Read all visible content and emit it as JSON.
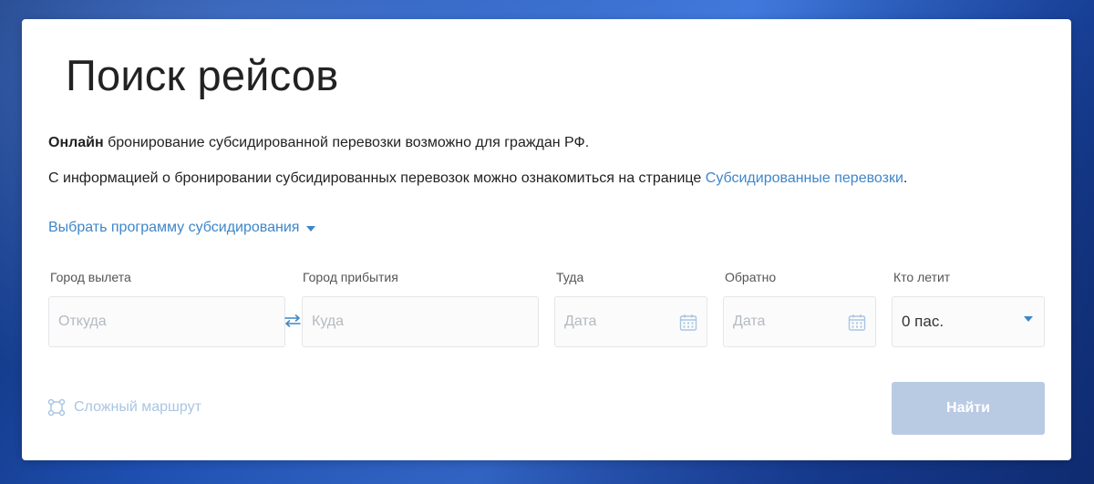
{
  "page": {
    "title": "Поиск рейсов"
  },
  "info": {
    "online_bold": "Онлайн",
    "online_rest": " бронирование субсидированной перевозки возможно для граждан РФ.",
    "info_text": "С информацией о бронировании субсидированных перевозок можно ознакомиться на странице ",
    "info_link": "Субсидированные перевозки",
    "info_end": "."
  },
  "program_selector": {
    "label": "Выбрать программу субсидирования",
    "icon": "caret-down-icon"
  },
  "form": {
    "from": {
      "label": "Город вылета",
      "placeholder": "Откуда"
    },
    "to": {
      "label": "Город прибытия",
      "placeholder": "Куда"
    },
    "depart": {
      "label": "Туда",
      "placeholder": "Дата",
      "icon": "calendar-icon"
    },
    "return": {
      "label": "Обратно",
      "placeholder": "Дата",
      "icon": "calendar-icon"
    },
    "passengers": {
      "label": "Кто летит",
      "value": "0 пас."
    },
    "swap_icon": "swap-arrows-icon"
  },
  "actions": {
    "complex_route": "Сложный маршрут",
    "complex_route_icon": "route-nodes-icon",
    "find": "Найти"
  },
  "colors": {
    "accent": "#3f86c9",
    "button_disabled": "#b9cbe3",
    "muted_link": "#a9c6e2"
  }
}
